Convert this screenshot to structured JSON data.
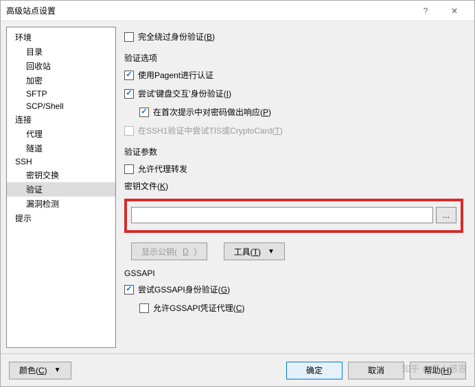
{
  "titlebar": {
    "title": "高级站点设置",
    "help": "?",
    "close": "✕"
  },
  "tree": {
    "items": [
      {
        "label": "环境",
        "level": 0
      },
      {
        "label": "目录",
        "level": 1
      },
      {
        "label": "回收站",
        "level": 1
      },
      {
        "label": "加密",
        "level": 1
      },
      {
        "label": "SFTP",
        "level": 1
      },
      {
        "label": "SCP/Shell",
        "level": 1
      },
      {
        "label": "连接",
        "level": 0
      },
      {
        "label": "代理",
        "level": 1
      },
      {
        "label": "隧道",
        "level": 1
      },
      {
        "label": "SSH",
        "level": 0
      },
      {
        "label": "密钥交换",
        "level": 1
      },
      {
        "label": "验证",
        "level": 1,
        "selected": true
      },
      {
        "label": "漏洞检测",
        "level": 1
      },
      {
        "label": "提示",
        "level": 0
      }
    ]
  },
  "main": {
    "bypass_auth": {
      "label_before": "完全绕过身份验证(",
      "hotkey": "B",
      "label_after": ")",
      "checked": false
    },
    "auth_options_label": "验证选项",
    "pagent": {
      "label": "使用Pagent进行认证",
      "checked": true
    },
    "keyboard_interactive": {
      "label_before": "尝试'键盘交互'身份验证(",
      "hotkey": "I",
      "label_after": ")",
      "checked": true
    },
    "respond_password": {
      "label_before": "在首次提示中对密码做出响应(",
      "hotkey": "P",
      "label_after": ")",
      "checked": true
    },
    "tis_crypto": {
      "label_before": "在SSH1验证中尝试TIS或CryptoCard(",
      "hotkey": "T",
      "label_after": ")",
      "checked": false,
      "disabled": true
    },
    "auth_params_label": "验证参数",
    "agent_forward": {
      "label": "允许代理转发",
      "checked": false
    },
    "key_file_label": {
      "label_before": "密钥文件(",
      "hotkey": "K",
      "label_after": ")"
    },
    "key_file_value": "",
    "browse_label": "...",
    "show_pubkey": {
      "label_before": "显示公钥(",
      "hotkey": "D",
      "label_after": ")"
    },
    "tools": {
      "label_before": "工具(",
      "hotkey": "T",
      "label_after": ")"
    },
    "gssapi_label": "GSSAPI",
    "gssapi_auth": {
      "label_before": "尝试GSSAPI身份验证(",
      "hotkey": "G",
      "label_after": ")",
      "checked": true
    },
    "gssapi_cred": {
      "label_before": "允许GSSAPI凭证代理(",
      "hotkey": "C",
      "label_after": ")",
      "checked": false
    }
  },
  "footer": {
    "color": {
      "label_before": "颜色(",
      "hotkey": "C",
      "label_after": ")"
    },
    "ok": "确定",
    "cancel": "取消",
    "help": {
      "label_before": "帮助(",
      "hotkey": "H",
      "label_after": ")"
    }
  },
  "watermark": "知乎 @开心感恩"
}
